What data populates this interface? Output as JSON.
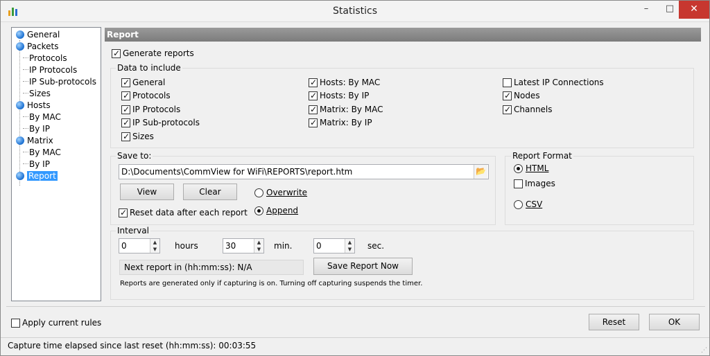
{
  "window": {
    "title": "Statistics"
  },
  "tree": {
    "items": [
      {
        "label": "General",
        "level": 0
      },
      {
        "label": "Packets",
        "level": 0
      },
      {
        "label": "Protocols",
        "level": 1
      },
      {
        "label": "IP Protocols",
        "level": 1
      },
      {
        "label": "IP Sub-protocols",
        "level": 1
      },
      {
        "label": "Sizes",
        "level": 1
      },
      {
        "label": "Hosts",
        "level": 0
      },
      {
        "label": "By MAC",
        "level": 1
      },
      {
        "label": "By IP",
        "level": 1
      },
      {
        "label": "Matrix",
        "level": 0
      },
      {
        "label": "By MAC",
        "level": 1
      },
      {
        "label": "By IP",
        "level": 1
      },
      {
        "label": "Report",
        "level": 0,
        "selected": true
      }
    ]
  },
  "report": {
    "header": "Report",
    "generate_reports": {
      "label": "Generate reports",
      "checked": true
    },
    "data_to_include": {
      "title": "Data to include",
      "col1": [
        {
          "label": "General",
          "checked": true
        },
        {
          "label": "Protocols",
          "checked": true
        },
        {
          "label": "IP Protocols",
          "checked": true
        },
        {
          "label": "IP Sub-protocols",
          "checked": true
        },
        {
          "label": "Sizes",
          "checked": true
        }
      ],
      "col2": [
        {
          "label": "Hosts: By MAC",
          "checked": true
        },
        {
          "label": "Hosts: By IP",
          "checked": true
        },
        {
          "label": "Matrix: By MAC",
          "checked": true
        },
        {
          "label": "Matrix: By IP",
          "checked": true
        }
      ],
      "col3": [
        {
          "label": "Latest IP Connections",
          "checked": false
        },
        {
          "label": "Nodes",
          "checked": true
        },
        {
          "label": "Channels",
          "checked": true
        }
      ]
    },
    "save_to": {
      "title": "Save to:",
      "path": "D:\\Documents\\CommView for WiFi\\REPORTS\\report.htm",
      "view_label": "View",
      "clear_label": "Clear",
      "overwrite_label": "Overwrite",
      "append_label": "Append",
      "mode": "append",
      "reset_label": "Reset data after each report",
      "reset_checked": true
    },
    "format": {
      "title": "Report Format",
      "html_label": "HTML",
      "images_label": "Images",
      "csv_label": "CSV",
      "selected": "html",
      "images_checked": false
    },
    "interval": {
      "title": "Interval",
      "hours_value": "0",
      "hours_label": "hours",
      "min_value": "30",
      "min_label": "min.",
      "sec_value": "0",
      "sec_label": "sec.",
      "next_report": "Next report in (hh:mm:ss): N/A",
      "save_now_label": "Save Report Now",
      "note": "Reports are generated only if capturing is on. Turning off capturing suspends the timer."
    }
  },
  "footer": {
    "apply_rules_label": "Apply current rules",
    "apply_rules_checked": false,
    "reset_label": "Reset",
    "ok_label": "OK"
  },
  "status": {
    "text": "Capture time elapsed since last reset (hh:mm:ss): 00:03:55"
  },
  "colors": {
    "header_bg": "#8a8a8a",
    "selection": "#3399ff",
    "close_button": "#c7372f",
    "tree_dot": "#1a6fd1"
  }
}
